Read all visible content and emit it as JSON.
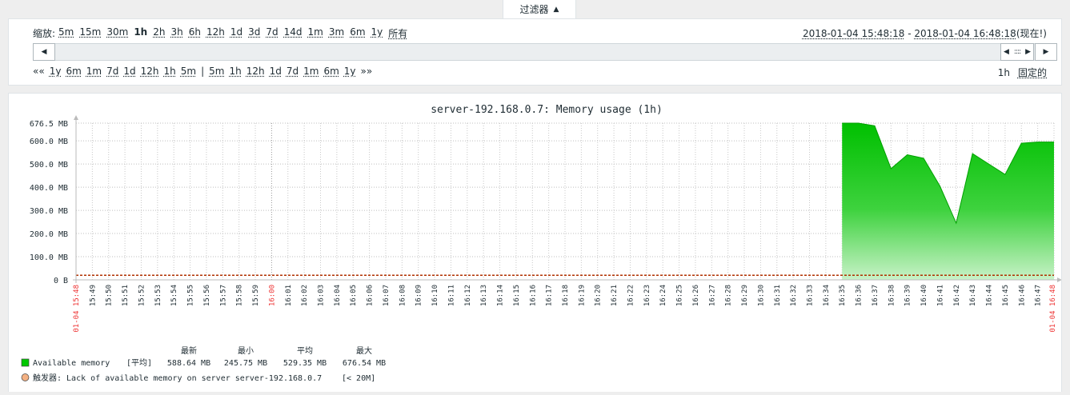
{
  "filter": {
    "tab_label": "过滤器",
    "tab_icon": "triangle-up-icon",
    "zoom_label": "缩放:",
    "zoom_options": [
      "5m",
      "15m",
      "30m",
      "1h",
      "2h",
      "3h",
      "6h",
      "12h",
      "1d",
      "3d",
      "7d",
      "14d",
      "1m",
      "3m",
      "6m",
      "1y",
      "所有"
    ],
    "zoom_active": "1h",
    "range_from": "2018-01-04 15:48:18",
    "range_sep": " - ",
    "range_to": "2018-01-04 16:48:18",
    "range_now": "(现在!)",
    "shift_back_prefix": "««",
    "shift_back": [
      "1y",
      "6m",
      "1m",
      "7d",
      "1d",
      "12h",
      "1h",
      "5m"
    ],
    "shift_divider": "|",
    "shift_forward": [
      "5m",
      "1h",
      "12h",
      "1d",
      "7d",
      "1m",
      "6m",
      "1y"
    ],
    "shift_forward_suffix": "»»",
    "period_value": "1h",
    "period_fixed": "固定的"
  },
  "chart_data": {
    "type": "area",
    "title": "server-192.168.0.7: Memory usage (1h)",
    "y_ticks": [
      "676.5 MB",
      "600.0 MB",
      "500.0 MB",
      "400.0 MB",
      "300.0 MB",
      "200.0 MB",
      "100.0 MB",
      "0 B"
    ],
    "ylim": [
      0,
      676.5
    ],
    "y_unit": "MB",
    "x_start_label": "01-04 15:48",
    "x_end_label": "01-04 16:48",
    "x_ticks": [
      "15:49",
      "15:50",
      "15:51",
      "15:52",
      "15:53",
      "15:54",
      "15:55",
      "15:56",
      "15:57",
      "15:58",
      "15:59",
      "16:00",
      "16:01",
      "16:02",
      "16:03",
      "16:04",
      "16:05",
      "16:06",
      "16:07",
      "16:08",
      "16:09",
      "16:10",
      "16:11",
      "16:12",
      "16:13",
      "16:14",
      "16:15",
      "16:16",
      "16:17",
      "16:18",
      "16:19",
      "16:20",
      "16:21",
      "16:22",
      "16:23",
      "16:24",
      "16:25",
      "16:26",
      "16:27",
      "16:28",
      "16:29",
      "16:30",
      "16:31",
      "16:32",
      "16:33",
      "16:34",
      "16:35",
      "16:36",
      "16:37",
      "16:38",
      "16:39",
      "16:40",
      "16:41",
      "16:42",
      "16:43",
      "16:44",
      "16:45",
      "16:46",
      "16:47",
      "16:48"
    ],
    "highlight_ticks": [
      "16:00"
    ],
    "series": [
      {
        "name": "Available memory",
        "color": "#00c800",
        "x": [
          "16:35",
          "16:36",
          "16:37",
          "16:38",
          "16:39",
          "16:40",
          "16:41",
          "16:42",
          "16:43",
          "16:44",
          "16:45",
          "16:46",
          "16:47",
          "16:48"
        ],
        "values": [
          676.5,
          676.5,
          665,
          480,
          540,
          525,
          405,
          245,
          545,
          500,
          455,
          590,
          595,
          595
        ]
      }
    ],
    "trigger_line": {
      "value": 20,
      "color": "#b03000"
    },
    "legend": {
      "headers": [
        "最新",
        "最小",
        "平均",
        "最大"
      ],
      "items": [
        {
          "label": "Available memory",
          "func": "[平均]",
          "last": "588.64 MB",
          "min": "245.75 MB",
          "avg": "529.35 MB",
          "max": "676.54 MB",
          "color": "#00c800"
        },
        {
          "label": "触发器: Lack of available memory on server server-192.168.0.7",
          "condition": "[< 20M]",
          "color": "#f4b183"
        }
      ]
    }
  }
}
